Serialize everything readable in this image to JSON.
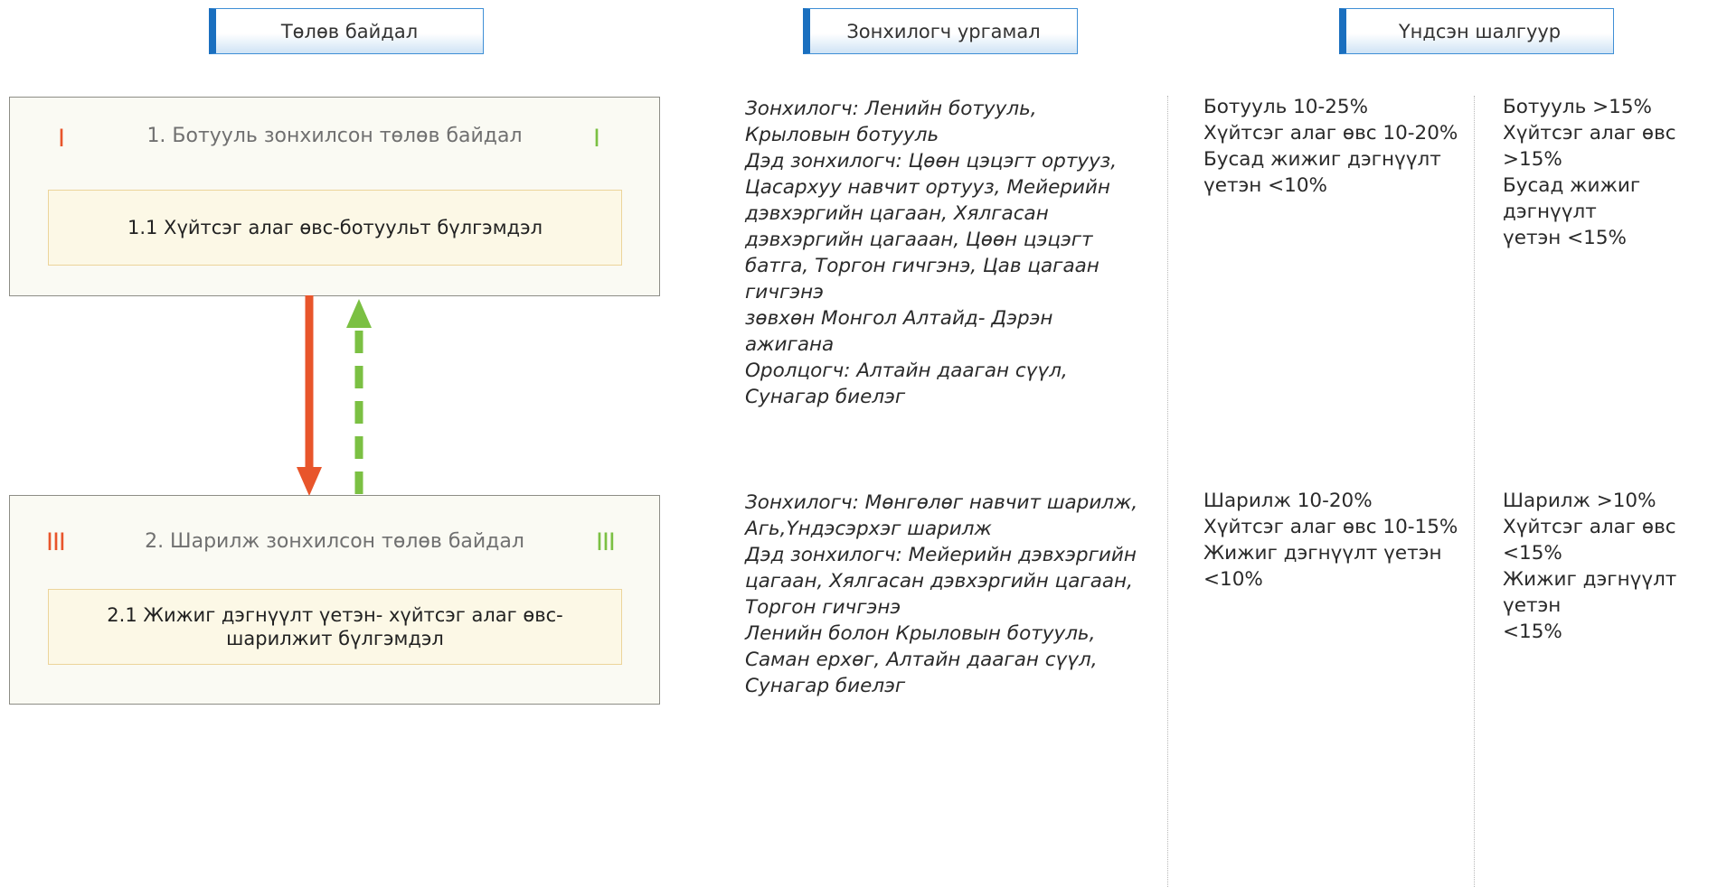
{
  "headers": {
    "states": "Төлөв байдал",
    "indicator_plants": "Зонхилогч ургамал",
    "criteria": "Үндсэн шалгуур"
  },
  "colors": {
    "header_accent": "#1a6fbf",
    "degradation_arrow": "#e8552b",
    "recovery_arrow": "#7bc043",
    "community_fill": "#fcf8e6"
  },
  "states": [
    {
      "title": "1. Ботууль зонхилсон төлөв байдал",
      "mark_left": "I",
      "mark_right": "I",
      "community": "1.1 Хүйтсэг алаг өвс-ботуульт бүлгэмдэл",
      "plants": [
        "Зонхилогч: Ленийн ботууль,",
        "Крыловын ботууль",
        "Дэд зонхилогч: Цөөн цэцэгт ортууз,",
        "Цасархуу навчит ортууз, Мейерийн",
        "дэвхэргийн цагаан, Хялгасан",
        "дэвхэргийн цагааан, Цөөн цэцэгт",
        "батга, Торгон гичгэнэ, Цав цагаан",
        "гичгэнэ",
        "зөвхөн Монгол Алтайд- Дэрэн",
        "ажигана",
        "Оролцогч: Алтайн дааган сүүл,",
        "Сунагар биелэг"
      ],
      "criteria_a": [
        "Ботууль 10-25%",
        "Хүйтсэг алаг өвс 10-20%",
        "Бусад жижиг дэгнүүлт",
        "үетэн <10%"
      ],
      "criteria_b": [
        "Ботууль >15%",
        "Хүйтсэг алаг өвс",
        ">15%",
        "Бусад жижиг дэгнүүлт",
        "үетэн <15%"
      ]
    },
    {
      "title": "2. Шарилж зонхилсон төлөв байдал",
      "mark_left": "III",
      "mark_right": "III",
      "community": "2.1 Жижиг дэгнүүлт үетэн- хүйтсэг алаг өвс-шарилжит бүлгэмдэл",
      "plants": [
        "Зонхилогч: Мөнгөлөг навчит шарилж,",
        "Агь,Үндэсэрхэг шарилж",
        "Дэд зонхилогч: Мейерийн дэвхэргийн",
        "цагаан, Хялгасан дэвхэргийн цагаан,",
        "Торгон гичгэнэ",
        "Ленийн болон Крыловын ботууль,",
        "Саман ерхөг, Алтайн дааган сүүл,",
        "Сунагар биелэг"
      ],
      "criteria_a": [
        "Шарилж 10-20%",
        "Хүйтсэг алаг өвс 10-15%",
        "Жижиг дэгнүүлт үетэн",
        "<10%"
      ],
      "criteria_b": [
        "Шарилж >10%",
        "Хүйтсэг алаг өвс",
        "<15%",
        "Жижиг дэгнүүлт үетэн",
        "<15%"
      ]
    }
  ]
}
